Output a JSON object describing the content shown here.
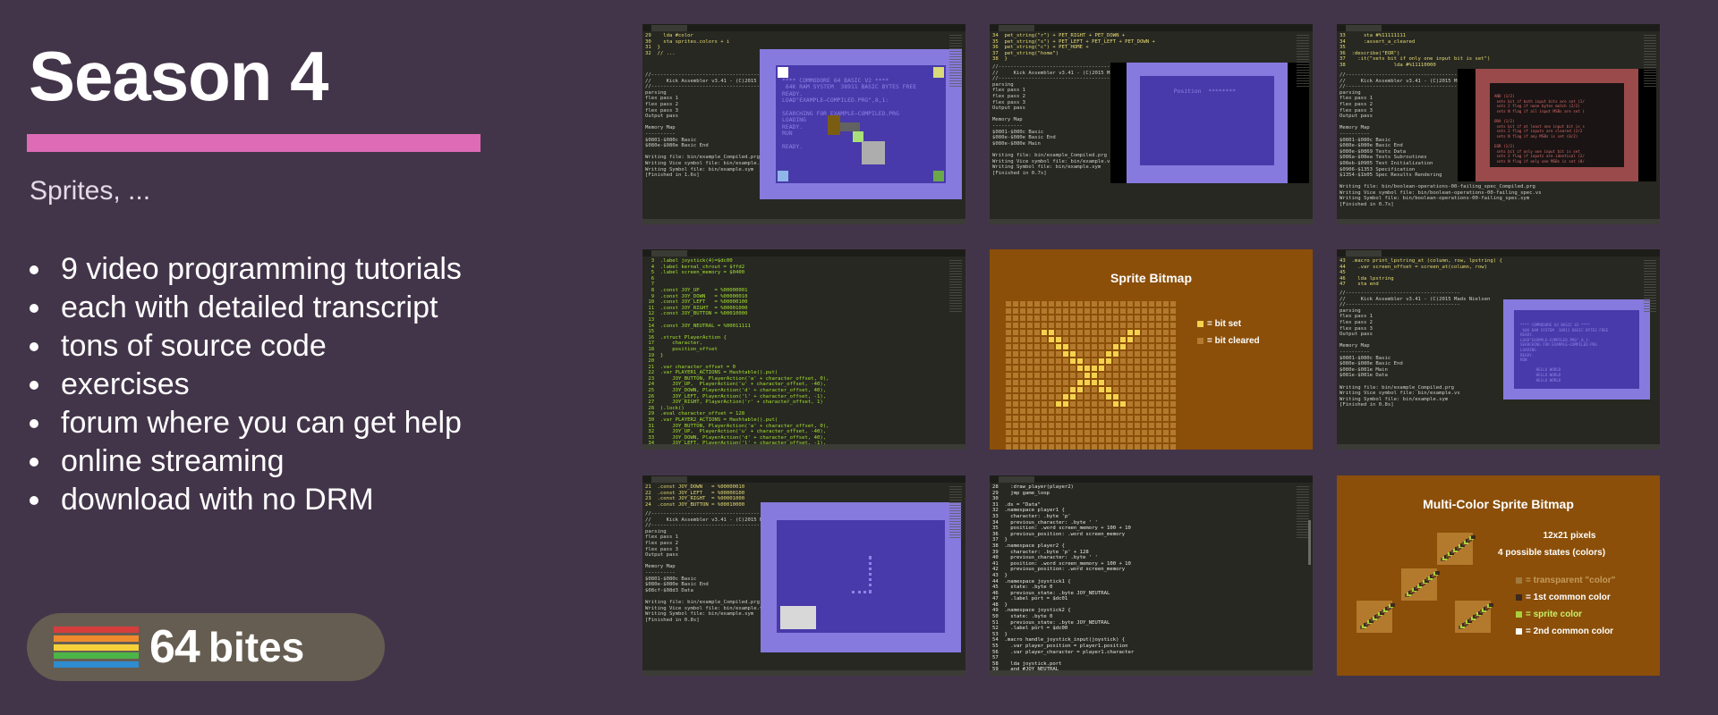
{
  "title": "Season 4",
  "subtitle": "Sprites, ...",
  "accent_color": "#dd6bb6",
  "features": [
    "9 video programming tutorials",
    "each with detailed transcript",
    "tons of source code",
    "exercises",
    "forum where you can get help",
    "online streaming",
    "download with no DRM"
  ],
  "logo": {
    "number": "64",
    "word": "bites",
    "stripe_colors": [
      "#d63d3d",
      "#ef8b2c",
      "#f5d03a",
      "#4cb548",
      "#2e8ccf"
    ]
  },
  "thumbnails": {
    "t1": {
      "code": "29    lda #color\n30    sta sprites.colors + i\n31  }\n32  // ...",
      "log": "//--------------------------------------\n//     Kick Assembler v3.41 - (C)2015 Mad\n//--------------------------------------\nparsing\nflex pass 1\nflex pass 2\nflex pass 3\nOutput pass\n\nMemory Map\n----------\n$0801-$080c Basic\n$080e-$080e Basic End\n\nWriting file: bin/example_Compiled.prg\nWriting Vice symbol file: bin/example.vs\nWriting Symbol file: bin/example.sym\n[Finished in 1.6s]",
      "screen": "**** COMMODORE 64 BASIC V2 ****\n 64K RAM SYSTEM  38911 BASIC BYTES FREE\nREADY.\nLOAD\"EXAMPLE—COMPILED.PRG\",8,1:\n\nSEARCHING FOR EXAMPLE—COMPILED.PRG\nLOADING\nREADY.\nRUN\n\nREADY."
    },
    "t2": {
      "code": "34  pet_string(\"r\") + PET_RIGHT + PET_DOWN +\n35  pet_string(\"s\") + PET_LEFT + PET_LEFT + PET_DOWN +\n36  pet_string(\"c\") + PET_HOME +\n37  pet_string(\"home\")\n38  }",
      "log": "//--------------------------------------\n//     Kick Assembler v3.41 - (C)2015 Mad\n//--------------------------------------\nparsing\nflex pass 1\nflex pass 2\nflex pass 3\nOutput pass\n\nMemory Map\n----------\n$0801-$080c Basic\n$080e-$080e Basic End\n$080e-$080e Main\n\nWriting file: bin/example_Compiled.prg\nWriting Vice symbol file: bin/example.vs\nWriting Symbol file: bin/example.sym\n[Finished in 0.7s]",
      "screen": "        Position  ********"
    },
    "t3": {
      "code": "33      sta #%11111111\n34      :assert_a_cleared\n35\n36  :describe(\"EOR\")\n37    :it(\"sets bit if only one input bit is set\")\n38                lda #%11110000",
      "log": "//--------------------------------------\n//     Kick Assembler v3.41 - (C)2015 Mad\n//--------------------------------------\nparsing\nflex pass 1\nflex pass 2\nflex pass 3\nOutput pass\n\nMemory Map\n----------\n$0801-$080c Basic\n$080e-$080e Basic End\n$080e-$0869 Tests Data\n$086a-$08ea Tests Subroutines\n$08eb-$0905 Test Initialization\n$0906-$1353 Specification\n$1354-$1b05 Spec Results Rendering\n\nWriting file: bin/boolean-operations-00-failing_spec_Compiled.prg\nWriting Vice symbol file: bin/boolean-operations-00-failing_spec.vs\nWriting Symbol file: bin/boolean-operations-00-failing_spec.sym\n[Finished in 0.7s]",
      "screen": "AND (1/2)\n sets bit if both input bits are set (1/\n sets 2 flag if none bytes match (2/2)\n sets N flag if all input MSBs are set (\n\nORA (1/2)\n sets bit if at least one input bit is s\n sets 2 flag if inputs are cleared (2/2\n sets N flag if any MSBs is set (0/2)\n\nEOR (1/2)\n sets bit if only one input bit is set\n sets 2 flag if inputs are identical (2/\n sets N flag if only one MSBs is set (0/"
    },
    "t4": {
      "code": "  3  .label joystick(4)=$dc00\n  4  .label kernal_chrout = $ffd2\n  5  .label screen_memory = $0400\n  6\n  7\n  8  .const JOY_UP     = %00000001\n  9  .const JOY_DOWN   = %00000010\n 10  .const JOY_LEFT   = %00000100\n 11  .const JOY_RIGHT  = %00001000\n 12  .const JOY_BUTTON = %00010000\n 13\n 14  .const JOY_NEUTRAL = %00011111\n 15\n 16  .struct PlayerAction {\n 17      character,\n 18      position_offset\n 19  }\n 20\n 21  .var character_offset = 0\n 22  .var PLAYER1_ACTIONS = Hashtable().put(\n 23      JOY_BUTTON, PlayerAction('a' + character_offset, 0),\n 24      JOY_UP,  PlayerAction('u' + character_offset, -40),\n 25      JOY_DOWN, PlayerAction('d' + character_offset, 40),\n 26      JOY_LEFT, PlayerAction('l' + character_offset, -1),\n 27      JOY_RIGHT, PlayerAction('r' + character_offset, 1)\n 28  ).lock()\n 29  .eval character_offset = 128\n 30  .var PLAYER2_ACTIONS = Hashtable().put(\n 31      JOY_BUTTON, PlayerAction('a' + character_offset, 0),\n 32      JOY_UP,  PlayerAction('u' + character_offset, -40),\n 33      JOY_DOWN, PlayerAction('d' + character_offset, 40),\n 34      JOY_LEFT, PlayerAction('l' + character_offset, -1),\n 35      JOY_RIGHT, PlayerAction('r' + character_offset, 1)\n 36  ).lock()"
    },
    "t5": {
      "title": "Sprite Bitmap",
      "legend": [
        "= bit set",
        "= bit cleared"
      ],
      "bitmap": [
        "000000000000000000000000",
        "000000000000000000000000",
        "000000000000000000000000",
        "000000000000000000000000",
        "000001100000000001100000",
        "000000110000000011000000",
        "000000011000000110000000",
        "000000001100001100000000",
        "000000000110011000000000",
        "000000000011110000000000",
        "000000000001100000000000",
        "000000000011110000000000",
        "000000000110011000000000",
        "000000001100001100000000",
        "000000011000000110000000",
        "000000000000000000000000",
        "000000000000000000000000",
        "000000000000000000000000",
        "000000000000000000000000",
        "000000000000000000000000",
        "000000000000000000000000"
      ]
    },
    "t6": {
      "code": "43  .macro print_lpstring_at (column, row, lpstring) {\n44    .var screen_offset = screen_at(column, row)\n45\n46    lda lpstring\n47    sta end",
      "log": "//--------------------------------------\n//     Kick Assembler v3.41 - (C)2015 Mads Nielsen\n//--------------------------------------\nparsing\nflex pass 1\nflex pass 2\nflex pass 3\nOutput pass\n\nMemory Map\n----------\n$0801-$080c Basic\n$080e-$080e Basic End\n$080e-$081e Main\n$081e-$081e Data\n\nWriting file: bin/example_Compiled.prg\nWriting Vice symbol file: bin/example.vs\nWriting Symbol file: bin/example.sym\n[Finished in 0.8s]",
      "screen": "**** COMMODORE 64 BASIC V2 ****\n 64K RAM SYSTEM  38911 BASIC BYTES FREE\nREADY.\nLOAD\"EXAMPLE—COMPILED.PRG\",8,1:\nSEARCHING FOR EXAMPLE—COMPILED.PRG\nLOADING\nREADY.\nRUN\n\n       HELLO WORLD\n       HELLO WORLD\n       HELLO WORLD"
    },
    "t7": {
      "code": "21  .const JOY_DOWN   = %00000010\n22  .const JOY_LEFT   = %00000100\n23  .const JOY_RIGHT  = %00001000\n24  .const JOY_BUTTON = %00010000",
      "log": "//--------------------------------------\n//     Kick Assembler v3.41 - (C)2015 Mad\n//--------------------------------------\nparsing\nflex pass 1\nflex pass 2\nflex pass 3\nOutput pass\n\nMemory Map\n----------\n$0801-$080c Basic\n$080e-$080e Basic End\n$08cf-$08d3 Data\n\nWriting file: bin/example_Compiled.prg\nWriting Vice symbol file: bin/example.vs\nWriting Symbol file: bin/example.sym\n[Finished in 0.8s]"
    },
    "t8": {
      "code": "28    :draw_player(player2)\n29    jmp game_loop\n30\n31  .ds = \"Data\"\n32  .namespace player1 {\n33    character: .byte 'p'\n34    previous_character: .byte ' '\n35    position: .word screen_memory + 100 + 10\n36    previous_position: .word screen_memory\n37  }\n38  .namespace player2 {\n39    character: .byte 'p' + 128\n40    previous_character: .byte ' '\n41    position: .word screen_memory + 100 + 10\n42    previous_position: .word screen_memory\n43  }\n44  .namespace joystick1 {\n45    state: .byte 0\n46    previous_state: .byte JOY_NEUTRAL\n47    .label port = $dc01\n48  }\n49  .namespace joystick2 {\n50    state: .byte 0\n51    previous_state: .byte JOY_NEUTRAL\n52    .label port = $dc00\n53  }\n54  .macro handle_joystick_input(joystick) {\n55    .var player_position = player1.position\n56    .var player_character = player1.character\n57\n58    lda joystick.port\n59    and #JOY_NEUTRAL\n60    cmp joystick.state"
    },
    "t9": {
      "title": "Multi-Color Sprite Bitmap",
      "specs": [
        "12x21 pixels",
        "4 possible states (colors)"
      ],
      "legend": [
        "= transparent \"color\"",
        "= 1st common color",
        "= sprite color",
        "= 2nd common color"
      ],
      "legend_colors": [
        "#a07a3d",
        "#3b2a1e",
        "#a8d13a",
        "#ffffff"
      ]
    }
  }
}
